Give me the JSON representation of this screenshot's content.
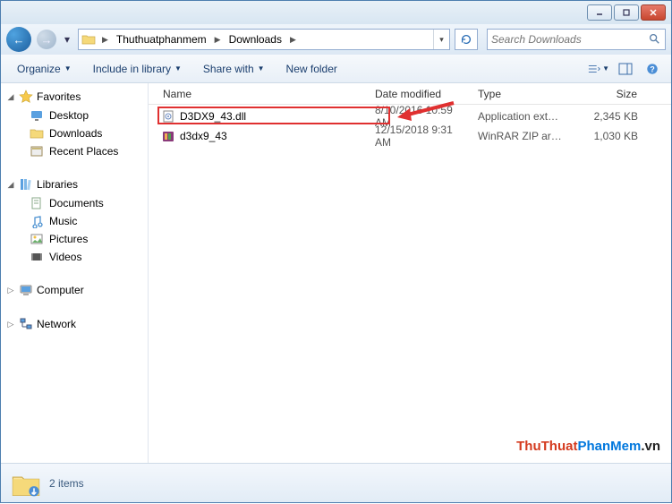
{
  "window": {
    "min": "–",
    "max": "▭",
    "close": "✕"
  },
  "nav": {
    "breadcrumbs": [
      "Thuthuatphanmem",
      "Downloads"
    ],
    "search_placeholder": "Search Downloads"
  },
  "toolbar": {
    "organize": "Organize",
    "include": "Include in library",
    "share": "Share with",
    "newfolder": "New folder"
  },
  "columns": {
    "name": "Name",
    "date": "Date modified",
    "type": "Type",
    "size": "Size"
  },
  "sidebar": {
    "favorites": "Favorites",
    "fav_items": [
      "Desktop",
      "Downloads",
      "Recent Places"
    ],
    "libraries": "Libraries",
    "lib_items": [
      "Documents",
      "Music",
      "Pictures",
      "Videos"
    ],
    "computer": "Computer",
    "network": "Network"
  },
  "files": [
    {
      "name": "D3DX9_43.dll",
      "date": "8/10/2016 10:59 AM",
      "type": "Application extens...",
      "size": "2,345 KB",
      "icon": "dll"
    },
    {
      "name": "d3dx9_43",
      "date": "12/15/2018 9:31 AM",
      "type": "WinRAR ZIP archive",
      "size": "1,030 KB",
      "icon": "zip"
    }
  ],
  "status": {
    "count": "2 items"
  },
  "watermark": {
    "a": "ThuThuat",
    "b": "PhanMem",
    "c": ".vn"
  }
}
